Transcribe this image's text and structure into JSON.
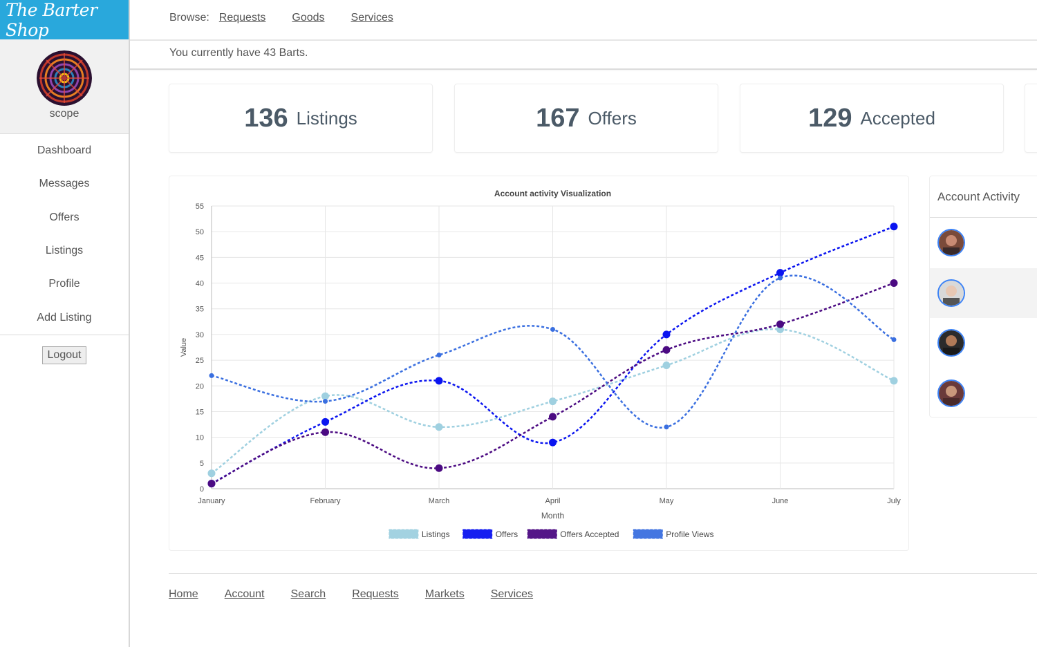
{
  "app": {
    "brand": "The Barter Shop"
  },
  "user": {
    "name": "scope"
  },
  "sidebar": {
    "items": [
      {
        "label": "Dashboard"
      },
      {
        "label": "Messages"
      },
      {
        "label": "Offers"
      },
      {
        "label": "Listings"
      },
      {
        "label": "Profile"
      },
      {
        "label": "Add Listing"
      }
    ],
    "logout_label": "Logout"
  },
  "header": {
    "browse_label": "Browse:",
    "browse_links": [
      "Requests",
      "Goods",
      "Services"
    ],
    "barts_message": "You currently have 43 Barts."
  },
  "stats": [
    {
      "value": "136",
      "label": "Listings"
    },
    {
      "value": "167",
      "label": "Offers"
    },
    {
      "value": "129",
      "label": "Accepted"
    }
  ],
  "activity": {
    "title": "Account Activity",
    "avatars": [
      "avatar-1",
      "avatar-2",
      "avatar-3",
      "avatar-4"
    ]
  },
  "footer": {
    "links": [
      "Home",
      "Account",
      "Search",
      "Requests",
      "Markets",
      "Services"
    ]
  },
  "chart_data": {
    "type": "line",
    "title": "Account activity Visualization",
    "xlabel": "Month",
    "ylabel": "Value",
    "categories": [
      "January",
      "February",
      "March",
      "April",
      "May",
      "June",
      "July"
    ],
    "ylim": [
      0,
      55
    ],
    "ytick_step": 5,
    "grid": true,
    "legend_position": "bottom",
    "series": [
      {
        "name": "Listings",
        "color": "#9fd0e0",
        "values": [
          3,
          18,
          12,
          17,
          24,
          31,
          21
        ]
      },
      {
        "name": "Offers",
        "color": "#0a14f0",
        "values": [
          1,
          13,
          21,
          9,
          30,
          42,
          51
        ]
      },
      {
        "name": "Offers Accepted",
        "color": "#4b0a82",
        "values": [
          1,
          11,
          4,
          14,
          27,
          32,
          40
        ]
      },
      {
        "name": "Profile Views",
        "color": "#3a6fe0",
        "values": [
          22,
          17,
          26,
          31,
          12,
          41,
          29
        ]
      }
    ]
  }
}
